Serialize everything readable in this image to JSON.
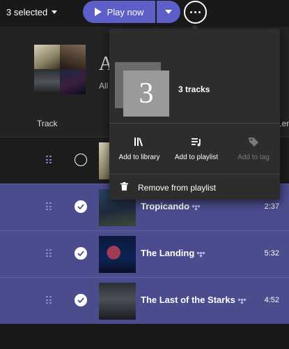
{
  "header": {
    "selected_label": "3 selected",
    "play_label": "Play now"
  },
  "playlist": {
    "title_initial": "A",
    "subtitle_fragment": "All",
    "columns": {
      "track": "Track",
      "length": "Length"
    }
  },
  "popover": {
    "count_number": "3",
    "count_label": "3 tracks",
    "actions": [
      {
        "label": "Add to library",
        "icon": "library-icon",
        "enabled": true
      },
      {
        "label": "Add to playlist",
        "icon": "playlist-add-icon",
        "enabled": true
      },
      {
        "label": "Add to tag",
        "icon": "tag-icon",
        "enabled": false
      }
    ],
    "remove_label": "Remove from playlist"
  },
  "tracks": [
    {
      "title": "",
      "duration": "",
      "selected": false
    },
    {
      "title": "Tropicando",
      "duration": "2:37",
      "selected": true
    },
    {
      "title": "The Landing",
      "duration": "5:32",
      "selected": true
    },
    {
      "title": "The Last of the Starks",
      "duration": "4:52",
      "selected": true
    }
  ],
  "colors": {
    "accent": "#5b5fc7",
    "selected_row": "#4a4c8e",
    "popover_bg": "#2d2d2d",
    "page_bg": "#191919"
  }
}
